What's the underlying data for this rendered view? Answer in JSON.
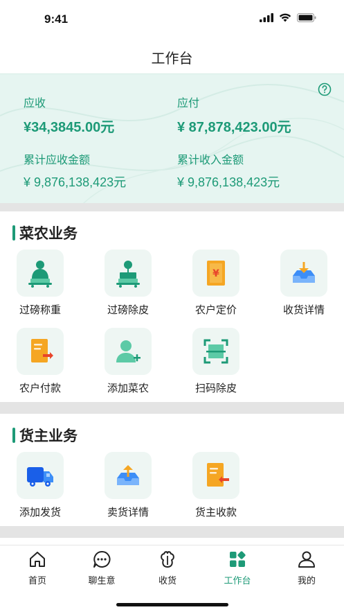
{
  "status_bar": {
    "time": "9:41"
  },
  "nav": {
    "title": "工作台"
  },
  "summary": {
    "receivable_label": "应收",
    "receivable_value": "¥34,3845.00元",
    "payable_label": "应付",
    "payable_value": "¥ 87,878,423.00元",
    "total_receivable_label": "累计应收金额",
    "total_receivable_value": "¥ 9,876,138,423元",
    "total_income_label": "累计收入金额",
    "total_income_value": "¥ 9,876,138,423元"
  },
  "farmer_section": {
    "title": "菜农业务",
    "items": [
      {
        "label": "过磅称重",
        "icon": "scale-weigh-icon"
      },
      {
        "label": "过磅除皮",
        "icon": "scale-tare-icon"
      },
      {
        "label": "农户定价",
        "icon": "price-document-icon"
      },
      {
        "label": "收货详情",
        "icon": "receive-download-icon"
      },
      {
        "label": "农户付款",
        "icon": "payment-document-icon"
      },
      {
        "label": "添加菜农",
        "icon": "add-user-icon"
      },
      {
        "label": "扫码除皮",
        "icon": "scan-icon"
      }
    ]
  },
  "owner_section": {
    "title": "货主业务",
    "items": [
      {
        "label": "添加发货",
        "icon": "truck-icon"
      },
      {
        "label": "卖货详情",
        "icon": "sell-upload-icon"
      },
      {
        "label": "货主收款",
        "icon": "collect-document-icon"
      }
    ]
  },
  "tabs": [
    {
      "label": "首页",
      "icon": "home-icon"
    },
    {
      "label": "聊生意",
      "icon": "chat-icon"
    },
    {
      "label": "收货",
      "icon": "vegetable-icon"
    },
    {
      "label": "工作台",
      "icon": "workbench-icon",
      "active": true
    },
    {
      "label": "我的",
      "icon": "user-icon"
    }
  ],
  "colors": {
    "accent": "#1d9a77",
    "orange": "#f5a623",
    "blue": "#3d8ef7"
  }
}
